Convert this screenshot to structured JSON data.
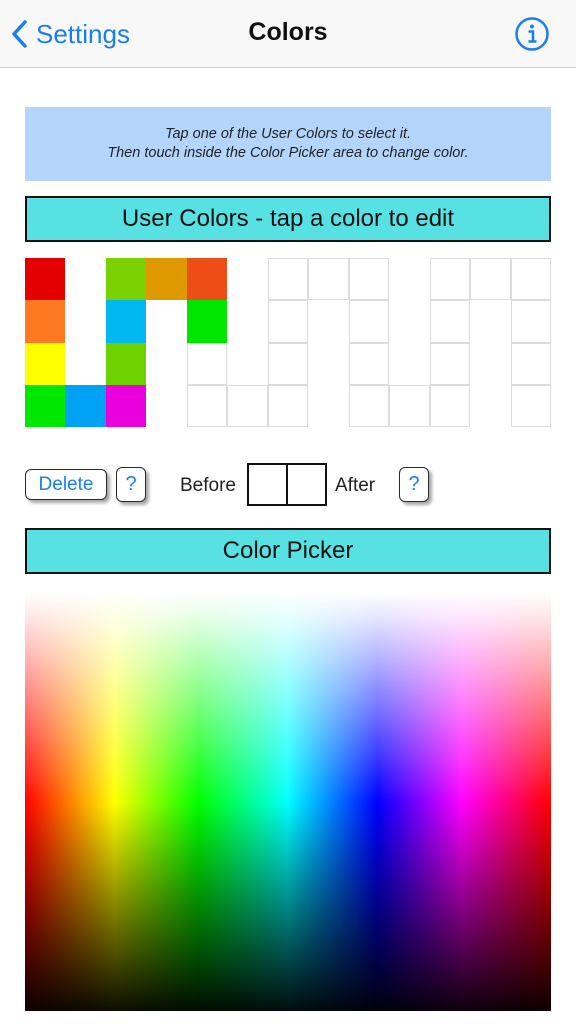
{
  "nav": {
    "back_label": "Settings",
    "title": "Colors",
    "back_icon": "chevron-left-icon",
    "info_icon": "info-circle-icon",
    "accent": "#1a7ef0"
  },
  "instructions": {
    "line1": "Tap one of the User Colors to select it.",
    "line2": "Then touch inside the Color Picker area to change color."
  },
  "user_colors": {
    "header": "User Colors - tap a color to edit",
    "header_color": "#57e1e3",
    "columns": 13,
    "rows": 4,
    "swatches": [
      {
        "row": 0,
        "col": 0,
        "color": "#e50000"
      },
      {
        "row": 0,
        "col": 2,
        "color": "#7ad000"
      },
      {
        "row": 0,
        "col": 3,
        "color": "#de9a00"
      },
      {
        "row": 0,
        "col": 4,
        "color": "#ec4e15"
      },
      {
        "row": 0,
        "col": 6,
        "color": null
      },
      {
        "row": 0,
        "col": 7,
        "color": null
      },
      {
        "row": 0,
        "col": 8,
        "color": null
      },
      {
        "row": 0,
        "col": 10,
        "color": null
      },
      {
        "row": 0,
        "col": 11,
        "color": null
      },
      {
        "row": 0,
        "col": 12,
        "color": null
      },
      {
        "row": 1,
        "col": 0,
        "color": "#ff7922"
      },
      {
        "row": 1,
        "col": 2,
        "color": "#00b8ef"
      },
      {
        "row": 1,
        "col": 4,
        "color": "#00e600"
      },
      {
        "row": 1,
        "col": 6,
        "color": null
      },
      {
        "row": 1,
        "col": 8,
        "color": null
      },
      {
        "row": 1,
        "col": 10,
        "color": null
      },
      {
        "row": 1,
        "col": 12,
        "color": null
      },
      {
        "row": 2,
        "col": 0,
        "color": "#ffff00"
      },
      {
        "row": 2,
        "col": 2,
        "color": "#6ed100"
      },
      {
        "row": 2,
        "col": 4,
        "color": null
      },
      {
        "row": 2,
        "col": 6,
        "color": null
      },
      {
        "row": 2,
        "col": 8,
        "color": null
      },
      {
        "row": 2,
        "col": 10,
        "color": null
      },
      {
        "row": 2,
        "col": 12,
        "color": null
      },
      {
        "row": 3,
        "col": 0,
        "color": "#00e700"
      },
      {
        "row": 3,
        "col": 1,
        "color": "#00a3f4"
      },
      {
        "row": 3,
        "col": 2,
        "color": "#ea00dc"
      },
      {
        "row": 3,
        "col": 4,
        "color": null
      },
      {
        "row": 3,
        "col": 5,
        "color": null
      },
      {
        "row": 3,
        "col": 6,
        "color": null
      },
      {
        "row": 3,
        "col": 8,
        "color": null
      },
      {
        "row": 3,
        "col": 9,
        "color": null
      },
      {
        "row": 3,
        "col": 10,
        "color": null
      },
      {
        "row": 3,
        "col": 12,
        "color": null
      }
    ]
  },
  "controls": {
    "delete_label": "Delete",
    "help_label": "?",
    "before_label": "Before",
    "after_label": "After",
    "before_color": "#ffffff",
    "after_color": "#ffffff"
  },
  "picker": {
    "header": "Color Picker"
  }
}
